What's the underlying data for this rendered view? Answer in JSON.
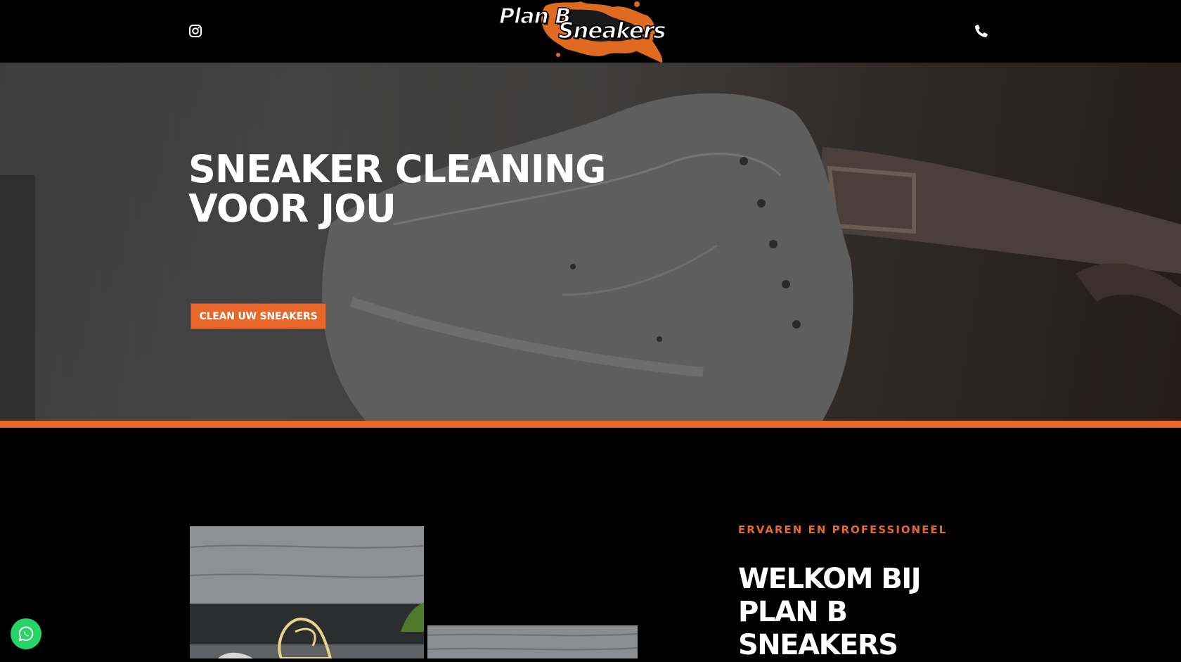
{
  "header": {
    "logo_text_line1": "Plan B",
    "logo_text_line2": "Sneakers",
    "instagram_icon": "instagram-icon",
    "phone_icon": "phone-icon"
  },
  "hero": {
    "title_line1": "SNEAKER CLEANING",
    "title_line2": "VOOR JOU",
    "cta_label": "CLEAN UW SNEAKERS"
  },
  "welcome": {
    "eyebrow": "ERVAREN EN PROFESSIONEEL",
    "title": "WELKOM BIJ PLAN B SNEAKERS"
  },
  "floating": {
    "whatsapp_icon": "whatsapp-icon"
  },
  "colors": {
    "accent": "#e8672a",
    "background": "#000000",
    "whatsapp": "#25d366"
  }
}
